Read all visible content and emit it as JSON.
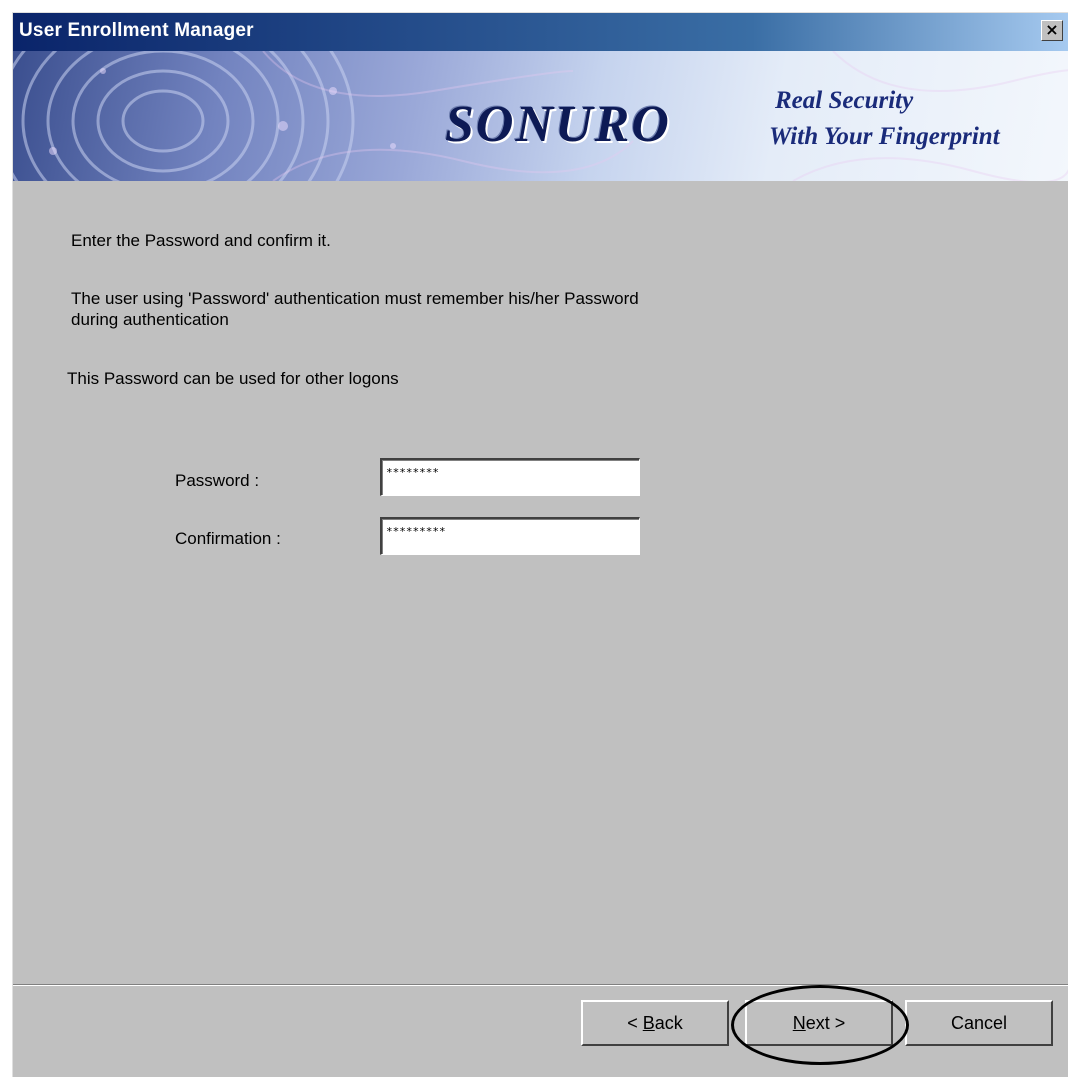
{
  "window": {
    "title": "User Enrollment Manager",
    "close_glyph": "×"
  },
  "banner": {
    "brand": "SONURO",
    "tagline_line1": "Real Security",
    "tagline_line2": "With Your  Fingerprint"
  },
  "instructions": {
    "line1": "Enter the Password and confirm it.",
    "line2a": "The user using 'Password' authentication must remember his/her Password",
    "line2b": "during authentication",
    "line3": "This Password can be used for other logons"
  },
  "form": {
    "password_label": "Password :",
    "password_value": "********",
    "confirmation_label": "Confirmation :",
    "confirmation_value": "*********"
  },
  "buttons": {
    "back_prefix": "< ",
    "back_accel": "B",
    "back_rest": "ack",
    "next_accel": "N",
    "next_rest": "ext >",
    "cancel": "Cancel"
  }
}
